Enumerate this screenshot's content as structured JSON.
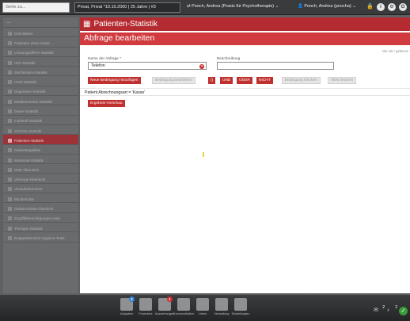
{
  "topbar": {
    "search_placeholder": "Gehe zu...",
    "patient": "Privat, Privat *10.10.2000 | 25 Jahre | #3",
    "user_practice": "Pooch, Andrea (Praxis für Psychotherapie)",
    "user_account": "Pooch, Andrea (poocha)",
    "icons": [
      "lock-icon",
      "help-icon",
      "settings-icon",
      "logout-icon"
    ]
  },
  "sidebar": {
    "header": "...",
    "items": [
      "Checklisten",
      "Patienten ohne Kasse",
      "Leistungsziffern-Statistik",
      "HZV-Statistik",
      "Sachkosten-Statistik",
      "HVM-Statistik",
      "Diagnosen-Statistik",
      "Medikamenten-Statistik",
      "Dauer-Statistik",
      "Impfstoff-Statistik",
      "Scheine-Statistik",
      "Patienten-Statistik",
      "Geburtstagsliste",
      "Wartezeit-Statistik",
      "DMP-Übersicht",
      "Vorsorge-Übersicht",
      "Verlaufsübersicht",
      "BG-Berichte",
      "Gebührenliste-Übersicht",
      "Zugriffsberechtigungen-Liste",
      "Therapie-Statistik",
      "Budgetübersicht Hygiene-Tests"
    ],
    "active_index": 11
  },
  "main": {
    "window_title": "Patienten-Statistik",
    "subtitle": "Abfrage bearbeiten",
    "required_note": "Die mit * gekennz",
    "name_label": "Name der Abfrage *",
    "name_value": "Telefon",
    "desc_label": "Beschreibung",
    "desc_value": "",
    "buttons": {
      "add_condition": "Neue Bedingung hinzufügen",
      "edit_condition": "Bedingung bearbeiten",
      "parens": "()",
      "and": "UND",
      "or": "ODER",
      "not": "NICHT",
      "delete_condition": "Bedingung löschen",
      "delete_all": "Alles löschen",
      "preview": "Ergebnis-Vorschau"
    },
    "condition": "Patient Abrechnungsart = 'Kasse'"
  },
  "taskbar": {
    "items": [
      {
        "label": "Aufgaben",
        "badge": "2",
        "badge_color": "#2f7fd6"
      },
      {
        "label": "Formulare",
        "badge": "",
        "badge_color": ""
      },
      {
        "label": "Auswertungen",
        "badge": "1",
        "badge_color": "#d32f2f"
      },
      {
        "label": "Kommunikation",
        "badge": "",
        "badge_color": ""
      },
      {
        "label": "Listen",
        "badge": "",
        "badge_color": ""
      },
      {
        "label": "Verwaltung",
        "badge": "",
        "badge_color": ""
      },
      {
        "label": "Einstellungen",
        "badge": "",
        "badge_color": ""
      }
    ],
    "mail_count": "2",
    "stetho_count": "2"
  },
  "colors": {
    "accent": "#b42c31",
    "button_red": "#c0302f",
    "active_item": "#a33035"
  }
}
